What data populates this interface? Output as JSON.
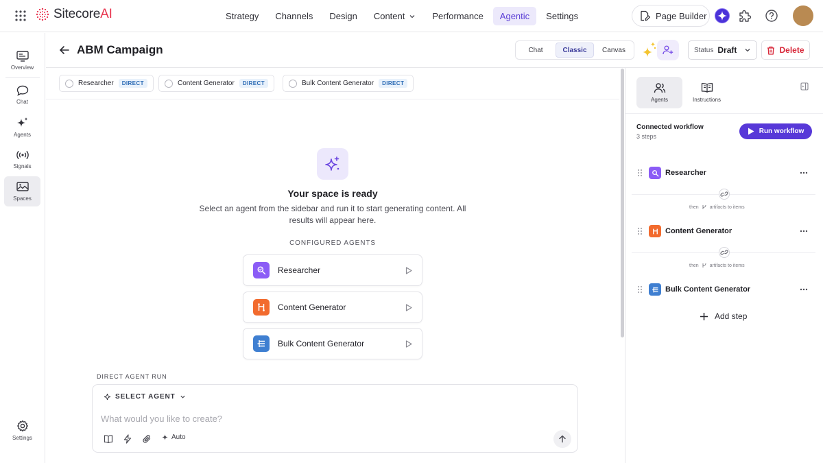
{
  "app": {
    "logo_text": "SitecoreAI"
  },
  "topnav": {
    "items": [
      {
        "label": "Strategy"
      },
      {
        "label": "Channels"
      },
      {
        "label": "Design"
      },
      {
        "label": "Content"
      },
      {
        "label": "Performance"
      },
      {
        "label": "Agentic"
      },
      {
        "label": "Settings"
      }
    ],
    "active": "Agentic",
    "page_builder_label": "Page Builder"
  },
  "rail": {
    "items": [
      {
        "label": "Overview"
      },
      {
        "label": "Chat"
      },
      {
        "label": "Agents"
      },
      {
        "label": "Signals"
      },
      {
        "label": "Spaces"
      }
    ],
    "active": "Spaces",
    "settings_label": "Settings"
  },
  "header": {
    "title": "ABM Campaign",
    "view_modes": [
      "Chat",
      "Classic",
      "Canvas"
    ],
    "active_view": "Classic",
    "status_key": "Status",
    "status_value": "Draft",
    "delete_label": "Delete"
  },
  "chips": [
    {
      "name": "Researcher",
      "badge": "DIRECT"
    },
    {
      "name": "Content Generator",
      "badge": "DIRECT"
    },
    {
      "name": "Bulk Content Generator",
      "badge": "DIRECT"
    }
  ],
  "empty_state": {
    "title": "Your space is ready",
    "subtitle": "Select an agent from the sidebar and run it to start generating content. All results will appear here.",
    "configured_label": "CONFIGURED AGENTS",
    "agents": [
      {
        "name": "Researcher",
        "icon": "researcher-icon",
        "color": "#8b5cf6"
      },
      {
        "name": "Content Generator",
        "icon": "content-generator-icon",
        "color": "#f26b2e"
      },
      {
        "name": "Bulk Content Generator",
        "icon": "bulk-generator-icon",
        "color": "#3f7fd1"
      }
    ]
  },
  "composer": {
    "section_label": "DIRECT AGENT RUN",
    "select_agent_label": "SELECT AGENT",
    "placeholder": "What would you like to create?",
    "auto_label": "Auto"
  },
  "right_panel": {
    "tabs": [
      {
        "label": "Agents"
      },
      {
        "label": "Instructions"
      }
    ],
    "active_tab": "Agents",
    "workflow_title": "Connected workflow",
    "workflow_steps": "3 steps",
    "run_label": "Run workflow",
    "steps": [
      {
        "name": "Researcher",
        "color": "#8b5cf6"
      },
      {
        "name": "Content Generator",
        "color": "#f26b2e"
      },
      {
        "name": "Bulk Content Generator",
        "color": "#3f7fd1"
      }
    ],
    "connector_then": "then",
    "connector_text": "artifacts to items",
    "add_step_label": "Add step"
  },
  "colors": {
    "accent": "#5738d8",
    "active_nav_bg": "#ece9fb",
    "delete": "#d8283a",
    "badge_text": "#2a6ab4"
  }
}
